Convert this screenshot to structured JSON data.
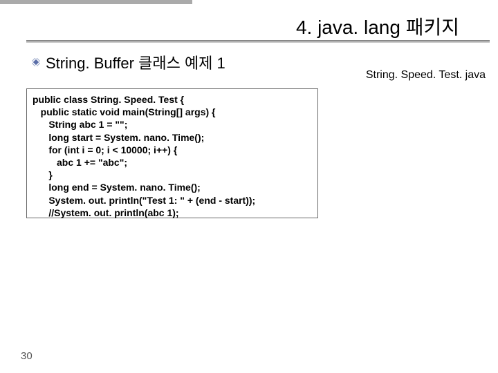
{
  "header": {
    "title": "4. java. lang 패키지"
  },
  "subtitle": {
    "text": "String. Buffer 클래스 예제 1"
  },
  "filename": "String. Speed. Test. java",
  "code": {
    "lines": [
      "public class String. Speed. Test {",
      "   public static void main(String[] args) {",
      "      String abc 1 = \"\";",
      "      long start = System. nano. Time();",
      "      for (int i = 0; i < 10000; i++) {",
      "         abc 1 += \"abc\";",
      "      }",
      "      long end = System. nano. Time();",
      "      System. out. println(\"Test 1: \" + (end - start));",
      "      //System. out. println(abc 1);"
    ]
  },
  "page_number": "30"
}
